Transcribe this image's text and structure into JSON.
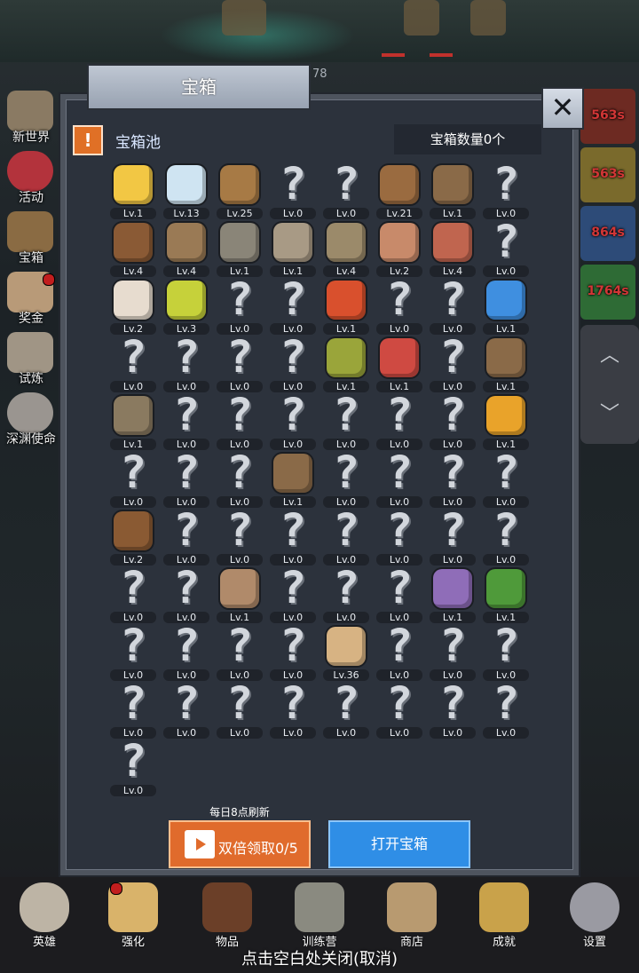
{
  "score_fragment": "78",
  "dialog": {
    "title": "宝箱",
    "pool_title": "宝箱池",
    "chest_count": "宝箱数量0个",
    "refresh_note": "每日8点刷新",
    "double_claim_label": "双倍领取0/5",
    "open_chest_label": "打开宝箱"
  },
  "left_nav": [
    {
      "label": "新世界",
      "icon": "map-icon",
      "color": "#8a7a63"
    },
    {
      "label": "活动",
      "icon": "heart-icon",
      "color": "#b3333c"
    },
    {
      "label": "宝箱",
      "icon": "chest-icon",
      "color": "#8a6b43"
    },
    {
      "label": "奖金",
      "icon": "envelope-icon",
      "color": "#b89a78"
    },
    {
      "label": "试炼",
      "icon": "wing-icon",
      "color": "#a09585"
    },
    {
      "label": "深渊使命",
      "icon": "orb-icon",
      "color": "#9a9590"
    }
  ],
  "right_nav": [
    {
      "timer": "563s",
      "color": "#6d2a22"
    },
    {
      "timer": "563s",
      "color": "#7a6a2c"
    },
    {
      "timer": "864s",
      "color": "#2d4b78"
    },
    {
      "timer": "1764s",
      "color": "#2e6b35"
    }
  ],
  "pool_rows": [
    [
      "Lv.1",
      "Lv.13",
      "Lv.25",
      "Lv.0",
      "Lv.0",
      "Lv.21",
      "Lv.1",
      "Lv.0"
    ],
    [
      "Lv.4",
      "Lv.4",
      "Lv.1",
      "Lv.1",
      "Lv.4",
      "Lv.2",
      "Lv.4",
      "Lv.0"
    ],
    [
      "Lv.2",
      "Lv.3",
      "Lv.0",
      "Lv.0",
      "Lv.1",
      "Lv.0",
      "Lv.0",
      "Lv.1"
    ],
    [
      "Lv.0",
      "Lv.0",
      "Lv.0",
      "Lv.0",
      "Lv.1",
      "Lv.1",
      "Lv.0",
      "Lv.1"
    ],
    [
      "Lv.1",
      "Lv.0",
      "Lv.0",
      "Lv.0",
      "Lv.0",
      "Lv.0",
      "Lv.0",
      "Lv.1"
    ],
    [
      "Lv.0",
      "Lv.0",
      "Lv.0",
      "Lv.1",
      "Lv.0",
      "Lv.0",
      "Lv.0",
      "Lv.0"
    ],
    [
      "Lv.2",
      "Lv.0",
      "Lv.0",
      "Lv.0",
      "Lv.0",
      "Lv.0",
      "Lv.0",
      "Lv.0"
    ],
    [
      "Lv.0",
      "Lv.0",
      "Lv.1",
      "Lv.0",
      "Lv.0",
      "Lv.0",
      "Lv.1",
      "Lv.1"
    ],
    [
      "Lv.0",
      "Lv.0",
      "Lv.0",
      "Lv.0",
      "Lv.36",
      "Lv.0",
      "Lv.0",
      "Lv.0"
    ],
    [
      "Lv.0",
      "Lv.0",
      "Lv.0",
      "Lv.0",
      "Lv.0",
      "Lv.0",
      "Lv.0",
      "Lv.0"
    ],
    [
      "Lv.0"
    ]
  ],
  "pool_items": [
    [
      "crown",
      "#f2c744",
      "diamond",
      "#cfe4f2",
      "sword",
      "#a77a45",
      "?",
      null,
      "?",
      null,
      "armor",
      "#9a6b40",
      "backpack",
      "#8a6a48",
      "?",
      null
    ],
    [
      "helmet",
      "#8a5a35",
      "dagger",
      "#9a7a55",
      "helm",
      "#8a8578",
      "hammer",
      "#a89a85",
      "knight-helm",
      "#9b8a6a",
      "meat",
      "#c88a6a",
      "steak",
      "#c0654f",
      "?",
      null
    ],
    [
      "bowl",
      "#e7dccf",
      "potion",
      "#c6d13a",
      "?",
      null,
      "?",
      null,
      "potion",
      "#d9502d",
      "?",
      null,
      "?",
      null,
      "potion",
      "#3f8fe0"
    ],
    [
      "?",
      null,
      "?",
      null,
      "?",
      null,
      "?",
      null,
      "bottle",
      "#9aa53a",
      "bottle",
      "#cf4a42",
      "?",
      null,
      "boot",
      "#8a6a48"
    ],
    [
      "boot",
      "#8a7a60",
      "?",
      null,
      "?",
      null,
      "?",
      null,
      "?",
      null,
      "?",
      null,
      "?",
      null,
      "torch",
      "#e9a32a"
    ],
    [
      "?",
      null,
      "?",
      null,
      "?",
      null,
      "staff",
      "#8a6a48",
      "?",
      null,
      "?",
      null,
      "?",
      null,
      "?",
      null
    ],
    [
      "bag",
      "#8a5a33",
      "?",
      null,
      "?",
      null,
      "?",
      null,
      "?",
      null,
      "?",
      null,
      "?",
      null,
      "?",
      null
    ],
    [
      "?",
      null,
      "?",
      null,
      "bow",
      "#b08a6a",
      "?",
      null,
      "?",
      null,
      "?",
      null,
      "monster",
      "#8f6db8",
      "emblem",
      "#4f9a3a"
    ],
    [
      "?",
      null,
      "?",
      null,
      "?",
      null,
      "?",
      null,
      "mug",
      "#d7b383",
      "?",
      null,
      "?",
      null,
      "?",
      null
    ],
    [
      "?",
      null,
      "?",
      null,
      "?",
      null,
      "?",
      null,
      "?",
      null,
      "?",
      null,
      "?",
      null,
      "?",
      null
    ],
    [
      "?",
      null
    ]
  ],
  "bottom_nav": [
    {
      "label": "英雄",
      "icon": "skull-icon",
      "color": "#bdb4a5"
    },
    {
      "label": "强化",
      "icon": "candle-icon",
      "color": "#d9b36a"
    },
    {
      "label": "物品",
      "icon": "book-icon",
      "color": "#6b3f28"
    },
    {
      "label": "训练营",
      "icon": "lantern-icon",
      "color": "#8a8a80"
    },
    {
      "label": "商店",
      "icon": "beer-mug-icon",
      "color": "#b89a70"
    },
    {
      "label": "成就",
      "icon": "key-icon",
      "color": "#c9a24a"
    },
    {
      "label": "设置",
      "icon": "gear-icon",
      "color": "#9a9aa2"
    }
  ],
  "close_hint": "点击空白处关闭(取消)"
}
